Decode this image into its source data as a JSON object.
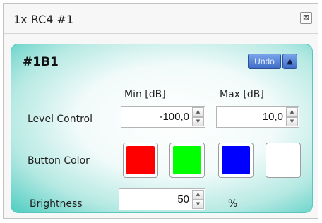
{
  "window": {
    "title": "1x RC4 #1",
    "close_glyph": "⊠"
  },
  "panel": {
    "title": "#1B1",
    "undo_label": "Undo",
    "collapse_glyph": "▲",
    "columns": {
      "min": "Min [dB]",
      "max": "Max [dB]"
    },
    "level_control": {
      "label": "Level Control",
      "min_value": "-100,0",
      "max_value": "10,0"
    },
    "button_color": {
      "label": "Button Color",
      "colors": [
        "#ff0000",
        "#00ff00",
        "#0000ff",
        "#ffffff"
      ]
    },
    "brightness": {
      "label": "Brightness",
      "value": "50",
      "unit": "%"
    }
  },
  "icons": {
    "spin_up": "▲",
    "spin_down": "▼"
  }
}
